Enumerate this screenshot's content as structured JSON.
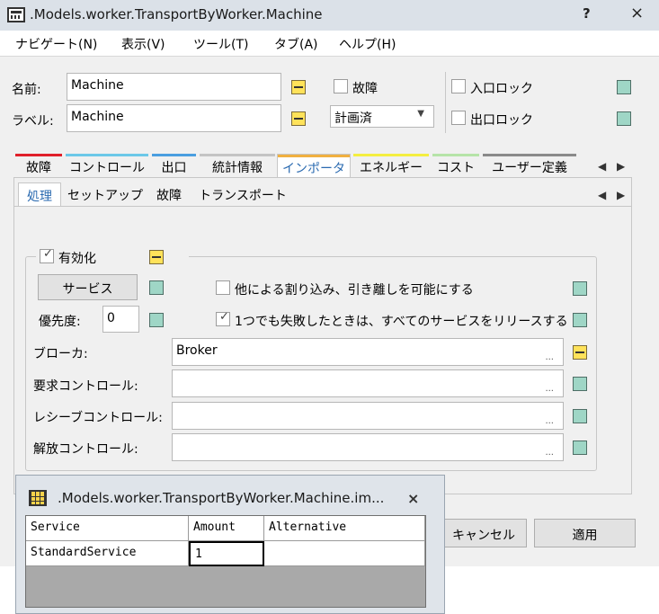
{
  "window": {
    "title": ".Models.worker.TransportByWorker.Machine",
    "help_glyph": "?",
    "close_glyph": "×"
  },
  "menu": [
    "ナビゲート(N)",
    "表示(V)",
    "ツール(T)",
    "タブ(A)",
    "ヘルプ(H)"
  ],
  "header": {
    "name_label": "名前:",
    "name_value": "Machine",
    "label_label": "ラベル:",
    "label_value": "Machine",
    "failure_label": "故障",
    "failure_checked": false,
    "status_value": "計画済",
    "entry_lock_label": "入口ロック",
    "entry_lock_checked": false,
    "exit_lock_label": "出口ロック",
    "exit_lock_checked": false
  },
  "tabs": [
    {
      "label": "故障",
      "color": "#e0202a",
      "active": false
    },
    {
      "label": "コントロール",
      "color": "#6cc8e8",
      "active": false
    },
    {
      "label": "出口",
      "color": "#4a9ee0",
      "active": false
    },
    {
      "label": "統計情報",
      "color": "#c4c4c4",
      "active": false
    },
    {
      "label": "インポータ",
      "color": "#f0b040",
      "active": true
    },
    {
      "label": "エネルギー",
      "color": "#f4ee40",
      "active": false
    },
    {
      "label": "コスト",
      "color": "#b6e4a8",
      "active": false
    },
    {
      "label": "ユーザー定義",
      "color": "#8a8a8a",
      "active": false
    }
  ],
  "subtabs": [
    {
      "label": "処理",
      "active": true
    },
    {
      "label": "セットアップ",
      "active": false
    },
    {
      "label": "故障",
      "active": false
    },
    {
      "label": "トランスポート",
      "active": false
    }
  ],
  "nav": {
    "left": "◀",
    "right": "▶",
    "ellipsis": "..."
  },
  "processing": {
    "enabled_label": "有効化",
    "enabled_checked": true,
    "services_button": "サービス",
    "priority_label": "優先度:",
    "priority_value": "0",
    "interrupt_label": "他による割り込み、引き離しを可能にする",
    "interrupt_checked": false,
    "release_label": "1つでも失敗したときは、すべてのサービスをリリースする",
    "release_checked": true,
    "broker_label": "ブローカ:",
    "broker_value": "Broker",
    "request_control_label": "要求コントロール:",
    "request_control_value": "",
    "receive_control_label": "レシーブコントロール:",
    "receive_control_value": "",
    "release_control_label": "解放コントロール:",
    "release_control_value": ""
  },
  "footer": {
    "cancel_label": "キャンセル",
    "apply_label": "適用"
  },
  "popup": {
    "title": ".Models.worker.TransportByWorker.Machine.im...",
    "close_glyph": "×",
    "columns": [
      "Service",
      "Amount",
      "Alternative"
    ],
    "rows": [
      [
        "StandardService",
        "1",
        ""
      ]
    ]
  }
}
